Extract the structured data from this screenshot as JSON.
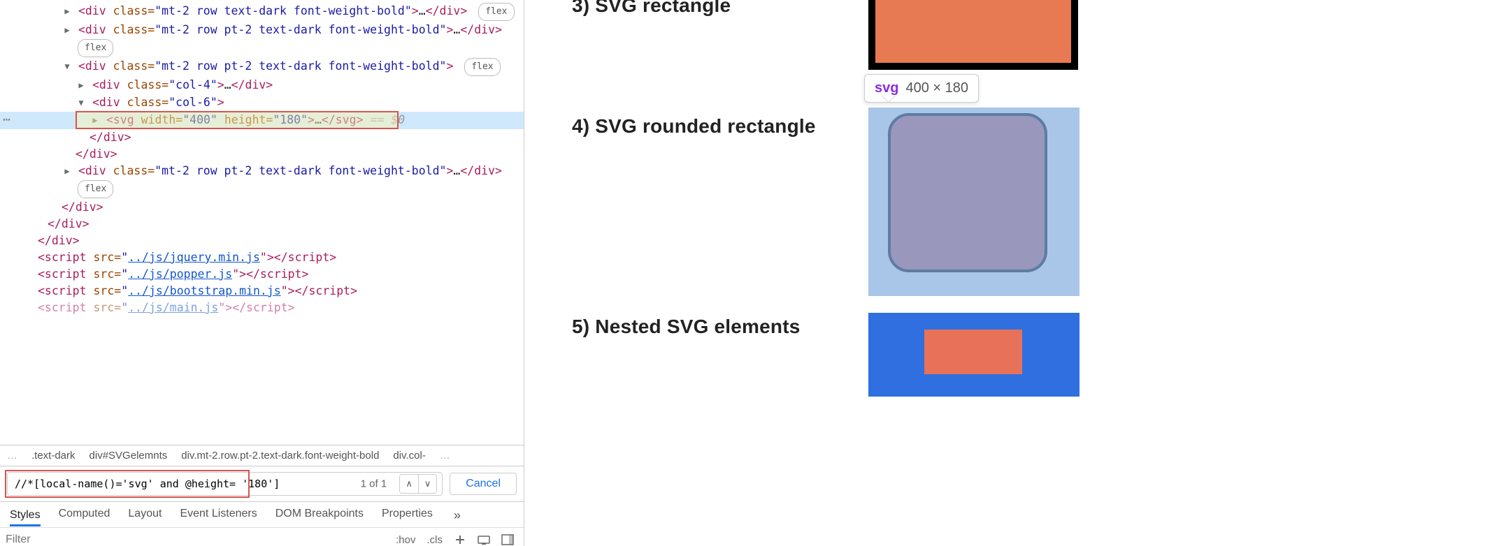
{
  "dom": {
    "line1": {
      "open": "<div ",
      "attr": "class=",
      "val": "\"mt-2 row text-dark font-weight-bold\"",
      "close1": ">",
      "dots": "…",
      "close2": "</div>",
      "flex": "flex"
    },
    "line2": {
      "open": "<div ",
      "attr": "class=",
      "val": "\"mt-2 row pt-2 text-dark font-weight-bold\"",
      "close1": ">",
      "dots": "…",
      "close2": "</div>"
    },
    "line2_flex": "flex",
    "line3": {
      "open": "<div ",
      "attr": "class=",
      "val": "\"mt-2 row pt-2 text-dark font-weight-bold\"",
      "close": ">",
      "flex": "flex"
    },
    "line4": {
      "open": "<div ",
      "attr": "class=",
      "val": "\"col-4\"",
      "close1": ">",
      "dots": "…",
      "close2": "</div>"
    },
    "line5": {
      "open": "<div ",
      "attr": "class=",
      "val": "\"col-6\"",
      "close": ">"
    },
    "line6": {
      "open": "<svg ",
      "attr1": "width=",
      "val1": "\"400\"",
      "attr2": "height=",
      "val2": "\"180\"",
      "close1": ">",
      "dots": "…",
      "close2": "</svg>",
      "eq": " == $0"
    },
    "enddiv": "</div>",
    "scripts": {
      "s1": {
        "pre": "<script ",
        "attr": "src=",
        "href": "../js/jquery.min.js",
        "mid": "\">",
        "close": "</scr"
      },
      "s2": {
        "pre": "<script ",
        "attr": "src=",
        "href": "../js/popper.js",
        "mid": "\">",
        "close": "</scr"
      },
      "s3": {
        "pre": "<script ",
        "attr": "src=",
        "href": "../js/bootstrap.min.js",
        "mid": "\">",
        "close": "</scr"
      },
      "s4": {
        "pre": "<script ",
        "attr": "src=",
        "href": "../js/main.js",
        "mid": "\">",
        "close": "</scr"
      }
    },
    "script_tag_end": "ipt>"
  },
  "breadcrumb": {
    "pre_ell": "…",
    "b1": ".text-dark",
    "b2": "div#SVGelemnts",
    "b3": "div.mt-2.row.pt-2.text-dark.font-weight-bold",
    "b4": "div.col-",
    "post_ell": "…"
  },
  "search": {
    "query": "//*[local-name()='svg' and @height= '180']",
    "result": "1 of 1",
    "cancel": "Cancel"
  },
  "tabs": {
    "t1": "Styles",
    "t2": "Computed",
    "t3": "Layout",
    "t4": "Event Listeners",
    "t5": "DOM Breakpoints",
    "t6": "Properties",
    "more": "»"
  },
  "styles": {
    "filter_placeholder": "Filter",
    "hov": ":hov",
    "cls": ".cls"
  },
  "preview": {
    "sec3": "3) SVG rectangle",
    "sec4": "4) SVG rounded rectangle",
    "sec5": "5) Nested SVG elements",
    "tooltip_tag": "svg",
    "tooltip_size": "400 × 180"
  }
}
